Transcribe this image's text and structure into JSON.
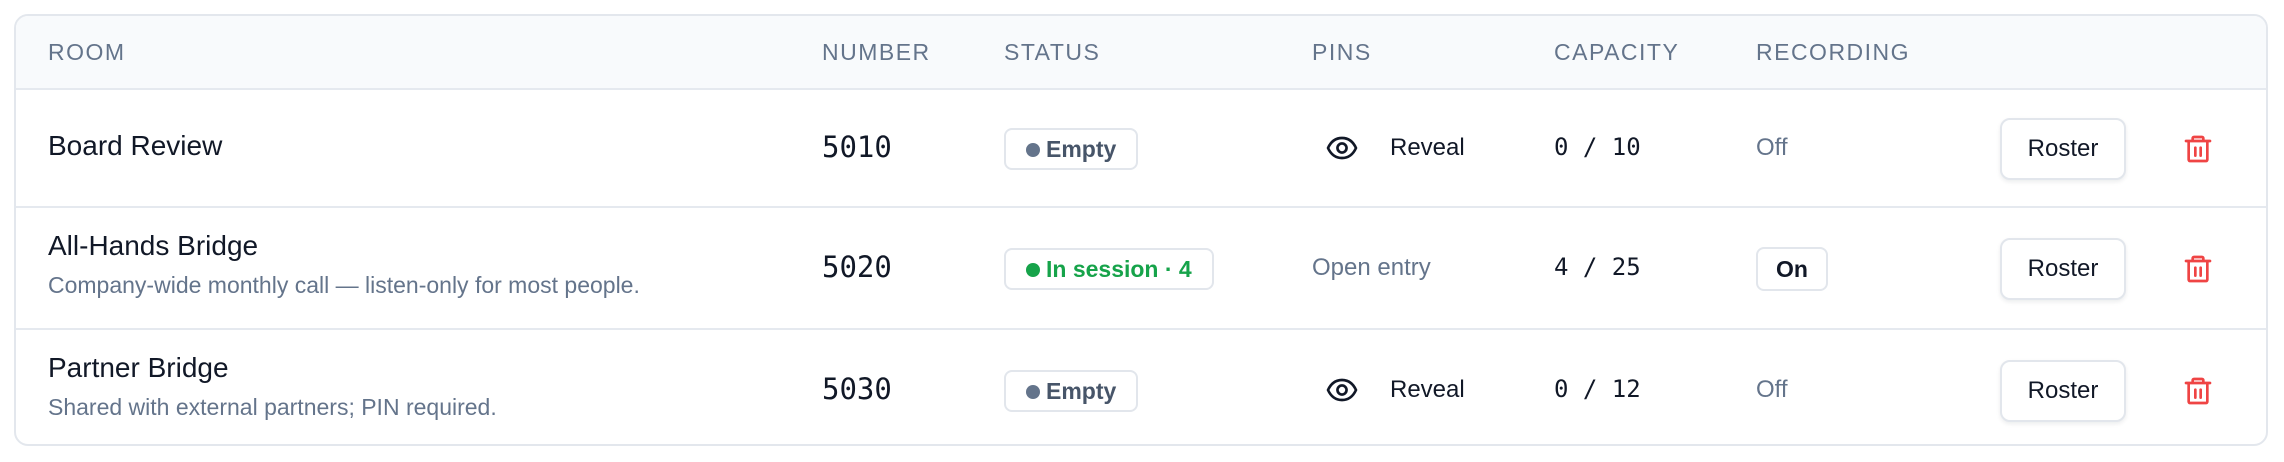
{
  "columns": {
    "room": "ROOM",
    "number": "NUMBER",
    "status": "STATUS",
    "pins": "PINS",
    "capacity": "CAPACITY",
    "recording": "RECORDING"
  },
  "rows": [
    {
      "name": "Board Review",
      "description": "",
      "number": "5010",
      "status": "Empty",
      "status_kind": "empty",
      "pins": "Reveal",
      "pins_kind": "reveal",
      "capacity": "0 / 10",
      "recording": "Off",
      "recording_kind": "off",
      "roster_label": "Roster",
      "delete_icon": "trash-icon"
    },
    {
      "name": "All-Hands Bridge",
      "description": "Company-wide monthly call — listen-only for most people.",
      "number": "5020",
      "status": "In session · 4",
      "status_kind": "live",
      "pins": "Open entry",
      "pins_kind": "text",
      "capacity": "4 / 25",
      "recording": "On",
      "recording_kind": "on",
      "roster_label": "Roster",
      "delete_icon": "trash-icon"
    },
    {
      "name": "Partner Bridge",
      "description": "Shared with external partners; PIN required.",
      "number": "5030",
      "status": "Empty",
      "status_kind": "empty",
      "pins": "Reveal",
      "pins_kind": "reveal",
      "capacity": "0 / 12",
      "recording": "Off",
      "recording_kind": "off",
      "roster_label": "Roster",
      "delete_icon": "trash-icon"
    }
  ],
  "colors": {
    "live": "#16a34a",
    "empty_dot": "#64748b",
    "danger": "#ef4444",
    "muted": "#64748b",
    "border": "#e5e9ef",
    "header_bg": "#f8fafc"
  }
}
